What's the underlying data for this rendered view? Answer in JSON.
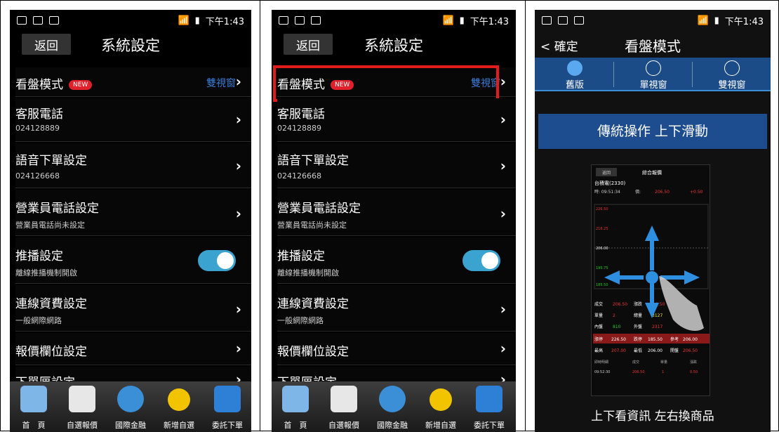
{
  "status": {
    "time": "下午1:43"
  },
  "settings": {
    "title": "系統設定",
    "back": "返回",
    "rows": [
      {
        "label": "看盤模式",
        "badge": "NEW",
        "right": "雙視窗"
      },
      {
        "label": "客服電話",
        "sub": "024128889"
      },
      {
        "label": "語音下單設定",
        "sub": "024126668"
      },
      {
        "label": "營業員電話設定",
        "sub": "營業員電話尚未設定"
      },
      {
        "label": "推播設定",
        "sub": "離線推播機制開啟",
        "toggle": true
      },
      {
        "label": "連線資費設定",
        "sub": "一般網際網路"
      },
      {
        "label": "報價欄位設定"
      },
      {
        "label": "下單匣設定"
      }
    ]
  },
  "tabs": [
    "首　頁",
    "自選報價",
    "國際金融",
    "新增自選",
    "委託下單"
  ],
  "view_mode": {
    "back": "< 確定",
    "title": "看盤模式",
    "options": [
      "舊版",
      "單視窗",
      "雙視窗"
    ],
    "selected": "舊版",
    "banner": "傳統操作 上下滑動",
    "footer": "上下看資訊 左右換商品"
  },
  "mini_screen": {
    "back": "返回",
    "menu": "綜合報價",
    "stock": "台積電(2330)",
    "time": "時: 09:51:34",
    "price_label": "價:",
    "price": "206.50",
    "change": "+0.50",
    "rows": [
      [
        "成交",
        "206.50",
        "漲跌",
        "+0.50"
      ],
      [
        "單量",
        "2",
        "總量",
        "3127"
      ],
      [
        "內盤",
        "810",
        "外盤",
        "2317"
      ],
      [
        "漲停",
        "226.50",
        "跌停",
        "185.50",
        "參考",
        "206.00"
      ],
      [
        "最高",
        "207.00",
        "最低",
        "206.00",
        "開盤",
        "206.50"
      ]
    ],
    "axis": [
      "226.50",
      "216.25",
      "206.00",
      "195.75",
      "185.50"
    ],
    "detail_header": [
      "即時明細",
      "成交",
      "單量",
      "漲跌"
    ],
    "detail_row": [
      "09:52:30",
      "206.50",
      "1",
      "0.50"
    ]
  },
  "colors": {
    "accent_blue": "#1e4d8f",
    "highlight_red": "#e31b1b",
    "toggle": "#3aa3d0"
  }
}
